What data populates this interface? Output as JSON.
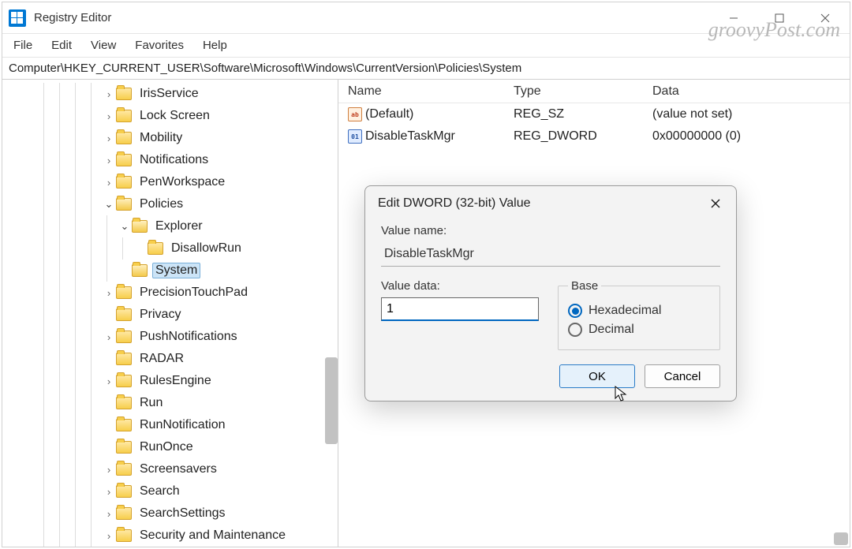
{
  "watermark": "groovyPost.com",
  "window": {
    "title": "Registry Editor"
  },
  "menubar": [
    "File",
    "Edit",
    "View",
    "Favorites",
    "Help"
  ],
  "address": "Computer\\HKEY_CURRENT_USER\\Software\\Microsoft\\Windows\\CurrentVersion\\Policies\\System",
  "tree": [
    {
      "depth": 7,
      "chev": ">",
      "label": "IrisService"
    },
    {
      "depth": 7,
      "chev": ">",
      "label": "Lock Screen"
    },
    {
      "depth": 7,
      "chev": ">",
      "label": "Mobility"
    },
    {
      "depth": 7,
      "chev": ">",
      "label": "Notifications"
    },
    {
      "depth": 7,
      "chev": ">",
      "label": "PenWorkspace"
    },
    {
      "depth": 7,
      "chev": "v",
      "open": true,
      "label": "Policies"
    },
    {
      "depth": 8,
      "chev": "v",
      "open": true,
      "label": "Explorer"
    },
    {
      "depth": 9,
      "chev": "",
      "label": "DisallowRun"
    },
    {
      "depth": 8,
      "chev": "",
      "open": true,
      "sel": true,
      "label": "System"
    },
    {
      "depth": 7,
      "chev": ">",
      "label": "PrecisionTouchPad"
    },
    {
      "depth": 7,
      "chev": "",
      "label": "Privacy"
    },
    {
      "depth": 7,
      "chev": ">",
      "label": "PushNotifications"
    },
    {
      "depth": 7,
      "chev": "",
      "label": "RADAR"
    },
    {
      "depth": 7,
      "chev": ">",
      "label": "RulesEngine"
    },
    {
      "depth": 7,
      "chev": "",
      "label": "Run"
    },
    {
      "depth": 7,
      "chev": "",
      "label": "RunNotification"
    },
    {
      "depth": 7,
      "chev": "",
      "label": "RunOnce"
    },
    {
      "depth": 7,
      "chev": ">",
      "label": "Screensavers"
    },
    {
      "depth": 7,
      "chev": ">",
      "label": "Search"
    },
    {
      "depth": 7,
      "chev": ">",
      "label": "SearchSettings"
    },
    {
      "depth": 7,
      "chev": ">",
      "label": "Security and Maintenance"
    }
  ],
  "cols": {
    "name": "Name",
    "type": "Type",
    "data": "Data"
  },
  "values": [
    {
      "icon": "sz",
      "name": "(Default)",
      "type": "REG_SZ",
      "data": "(value not set)"
    },
    {
      "icon": "dw",
      "name": "DisableTaskMgr",
      "type": "REG_DWORD",
      "data": "0x00000000 (0)"
    }
  ],
  "dialog": {
    "title": "Edit DWORD (32-bit) Value",
    "valueNameLabel": "Value name:",
    "valueName": "DisableTaskMgr",
    "valueDataLabel": "Value data:",
    "valueData": "1",
    "baseLabel": "Base",
    "hex": "Hexadecimal",
    "dec": "Decimal",
    "ok": "OK",
    "cancel": "Cancel"
  }
}
